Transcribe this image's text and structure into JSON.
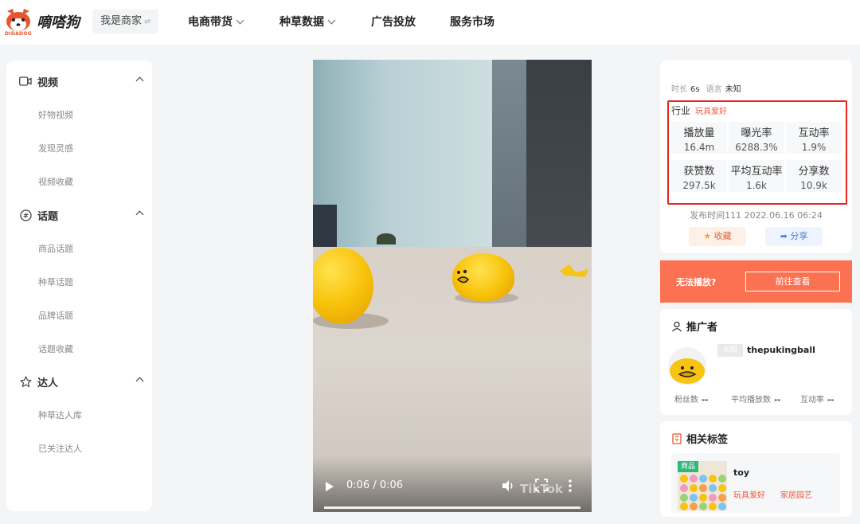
{
  "header": {
    "brand_name": "嘀嗒狗",
    "brand_sub": "DIDADOG",
    "merchant_label": "我是商家",
    "merchant_arrow": "⇌",
    "nav": [
      {
        "label": "电商带货",
        "has_dropdown": true
      },
      {
        "label": "种草数据",
        "has_dropdown": true
      },
      {
        "label": "广告投放",
        "has_dropdown": false
      },
      {
        "label": "服务市场",
        "has_dropdown": false
      }
    ]
  },
  "sidebar": {
    "sections": [
      {
        "title": "视频",
        "icon": "video-icon",
        "items": [
          "好物视频",
          "发现灵感",
          "视频收藏"
        ]
      },
      {
        "title": "话题",
        "icon": "hashtag-icon",
        "items": [
          "商品话题",
          "种草话题",
          "品牌话题",
          "话题收藏"
        ]
      },
      {
        "title": "达人",
        "icon": "star-icon",
        "items": [
          "种草达人库",
          "已关注达人"
        ]
      }
    ]
  },
  "video": {
    "time": "0:06 / 0:06",
    "watermark": "TikTok",
    "progress": 1.0
  },
  "detail": {
    "duration_label": "时长",
    "duration_value": "6s",
    "language_label": "语言",
    "language_value": "未知",
    "industry_label": "行业",
    "industry_value": "玩具爱好",
    "stats": [
      {
        "label": "播放量",
        "value": "16.4m"
      },
      {
        "label": "曝光率",
        "value": "6288.3%"
      },
      {
        "label": "互动率",
        "value": "1.9%"
      },
      {
        "label": "获赞数",
        "value": "297.5k"
      },
      {
        "label": "平均互动率",
        "value": "1.6k"
      },
      {
        "label": "分享数",
        "value": "10.9k"
      }
    ],
    "publish_time": "发布时间111 2022.06.16 06:24",
    "favorite_label": "收藏",
    "share_label": "分享"
  },
  "cta": {
    "text": "无法播放?",
    "button": "前往查看"
  },
  "promoter": {
    "title": "推广者",
    "badge": "未知",
    "name": "thepukingball",
    "stats": [
      {
        "label": "粉丝数",
        "value": "--"
      },
      {
        "label": "平均播放数",
        "value": "--"
      },
      {
        "label": "互动率",
        "value": "--"
      }
    ]
  },
  "tags": {
    "title": "相关标签",
    "badge": "商品",
    "name": "toy",
    "categories": [
      "玩具爱好",
      "家居园艺"
    ]
  },
  "colors": {
    "accent": "#fa7252",
    "highlight_border": "#e6241b",
    "industry": "#f0593a"
  }
}
